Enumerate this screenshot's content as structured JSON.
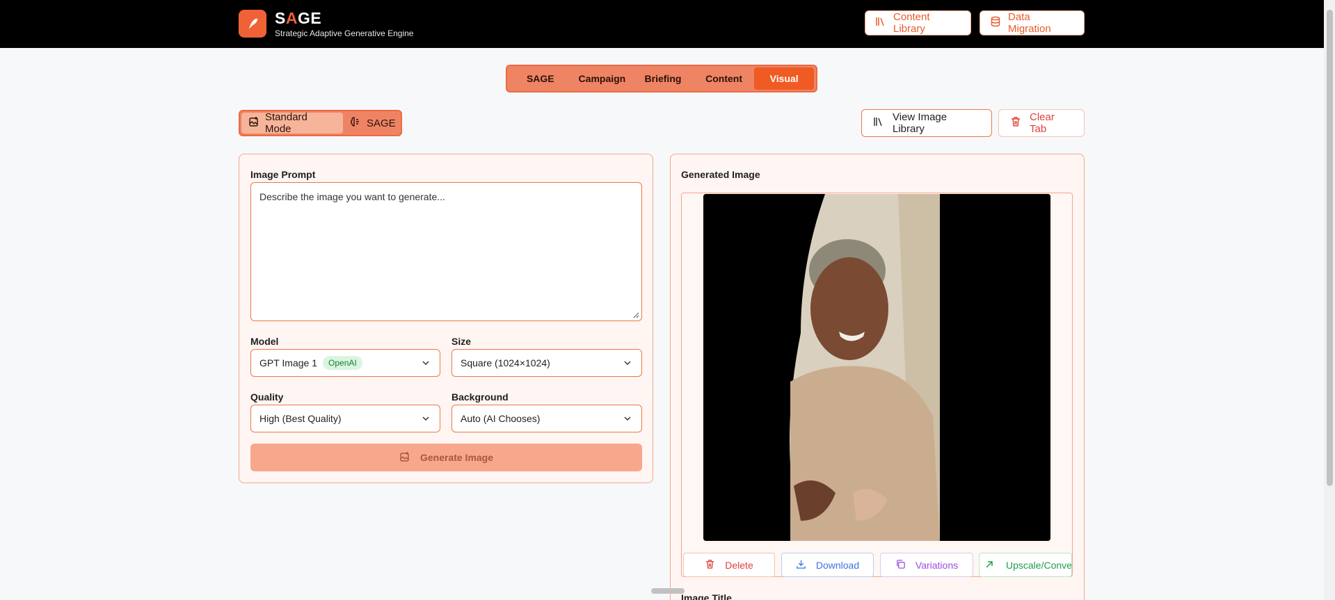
{
  "header": {
    "brand_name_first": "S",
    "brand_name_accent": "A",
    "brand_name_rest": "GE",
    "subtitle": "Strategic Adaptive Generative Engine",
    "buttons": [
      {
        "label": "Content Library",
        "icon": "library-icon"
      },
      {
        "label": "Data Migration",
        "icon": "database-icon"
      }
    ]
  },
  "tabs": [
    {
      "label": "SAGE",
      "active": false
    },
    {
      "label": "Campaign",
      "active": false
    },
    {
      "label": "Briefing",
      "active": false
    },
    {
      "label": "Content",
      "active": false
    },
    {
      "label": "Visual",
      "active": true
    }
  ],
  "modes": [
    {
      "label": "Standard Mode",
      "icon": "image-edit-icon",
      "active": true
    },
    {
      "label": "SAGE",
      "icon": "brain-icon",
      "active": false
    }
  ],
  "toolbar": {
    "view_library_label": "View Image Library",
    "clear_tab_label": "Clear Tab"
  },
  "form": {
    "prompt_label": "Image Prompt",
    "prompt_placeholder": "Describe the image you want to generate...",
    "model_label": "Model",
    "model_value": "GPT Image 1",
    "model_badge": "OpenAI",
    "size_label": "Size",
    "size_value": "Square (1024×1024)",
    "quality_label": "Quality",
    "quality_value": "High (Best Quality)",
    "background_label": "Background",
    "background_value": "Auto (AI Chooses)",
    "generate_label": "Generate Image"
  },
  "result": {
    "title": "Generated Image",
    "actions": [
      {
        "label": "Delete",
        "color": "#e0403a"
      },
      {
        "label": "Download",
        "color": "#3a73e0"
      },
      {
        "label": "Variations",
        "color": "#9a4fe0"
      },
      {
        "label": "Upscale/Convert",
        "color": "#1e9e4a"
      }
    ],
    "image_title_label": "Image Title"
  },
  "colors": {
    "accent": "#f06135",
    "panel_border": "#f3a78c",
    "panel_bg": "#fff5f2"
  }
}
